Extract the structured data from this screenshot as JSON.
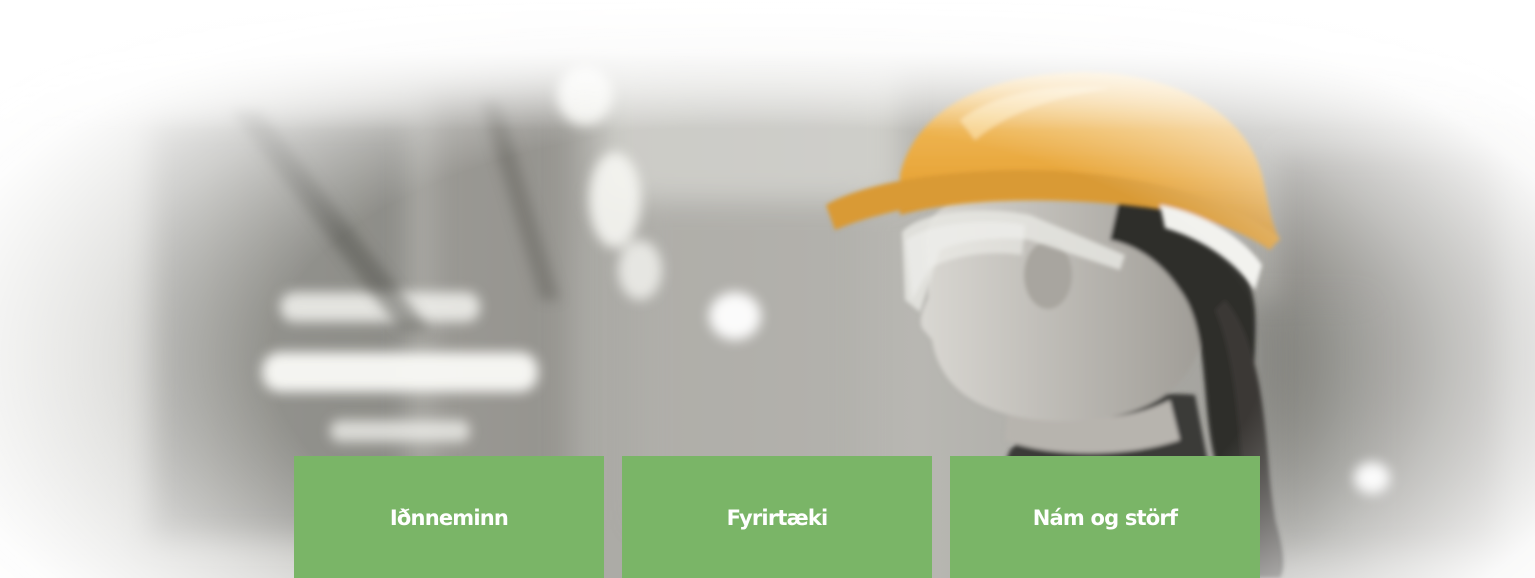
{
  "hero": {
    "image_subject": "worker-hardhat-safety-glasses-industrial-background",
    "accent_color": "#7ab567",
    "hardhat_color": "#e8a63a"
  },
  "tiles": [
    {
      "label": "Iðnneminn"
    },
    {
      "label": "Fyrirtæki"
    },
    {
      "label": "Nám og störf"
    }
  ]
}
